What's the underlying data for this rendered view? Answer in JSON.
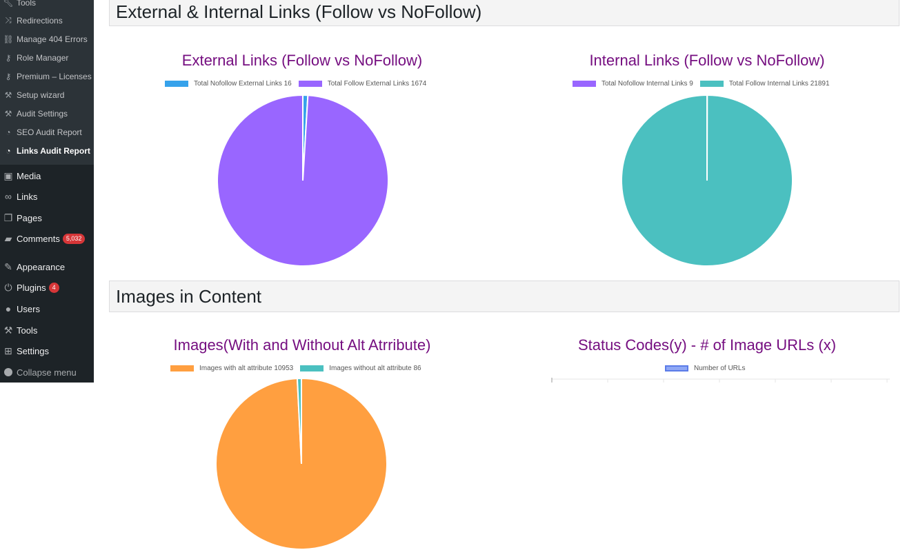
{
  "sidebar": {
    "submenu": [
      {
        "label": "Tools",
        "icon": "wrench-icon"
      },
      {
        "label": "Redirections",
        "icon": "shuffle-icon"
      },
      {
        "label": "Manage 404 Errors",
        "icon": "broken-link-icon"
      },
      {
        "label": "Role Manager",
        "icon": "key-icon"
      },
      {
        "label": "Premium – Licenses",
        "icon": "key-icon"
      },
      {
        "label": "Setup wizard",
        "icon": "wrench-icon"
      },
      {
        "label": "Audit Settings",
        "icon": "wrench-icon"
      },
      {
        "label": "SEO Audit Report",
        "icon": "gauge-icon"
      },
      {
        "label": "Links Audit Report",
        "icon": "gauge-icon"
      }
    ],
    "menu": [
      {
        "label": "Media",
        "icon": "media-icon"
      },
      {
        "label": "Links",
        "icon": "link-icon"
      },
      {
        "label": "Pages",
        "icon": "pages-icon"
      },
      {
        "label": "Comments",
        "icon": "comment-icon",
        "badge": "5,032"
      },
      {
        "label": "Appearance",
        "icon": "brush-icon"
      },
      {
        "label": "Plugins",
        "icon": "plugin-icon",
        "badge": "4"
      },
      {
        "label": "Users",
        "icon": "user-icon"
      },
      {
        "label": "Tools",
        "icon": "wrench-icon"
      },
      {
        "label": "Settings",
        "icon": "settings-icon"
      }
    ],
    "collapse_label": "Collapse menu"
  },
  "sections": {
    "links_title": "External & Internal Links (Follow vs NoFollow)",
    "images_title": "Images in Content"
  },
  "colors": {
    "blue": "#36a2eb",
    "purple": "#9966ff",
    "teal": "#4bc0c0",
    "orange": "#ff9f40",
    "title": "#750e80"
  },
  "chart_data": [
    {
      "type": "pie",
      "title": "External Links (Follow vs NoFollow)",
      "labels": [
        "Total Nofollow External Links 16",
        "Total Follow External Links 1674"
      ],
      "values": [
        16,
        1674
      ],
      "colors": [
        "#36a2eb",
        "#9966ff"
      ]
    },
    {
      "type": "pie",
      "title": "Internal Links (Follow vs NoFollow)",
      "labels": [
        "Total Nofollow Internal Links 9",
        "Total Follow Internal Links 21891"
      ],
      "values": [
        9,
        21891
      ],
      "colors": [
        "#9966ff",
        "#4bc0c0"
      ]
    },
    {
      "type": "pie",
      "title": "Images(With and Without Alt Atrribute)",
      "labels": [
        "Images with alt attribute 10953",
        "Images without alt attribute 86"
      ],
      "values": [
        10953,
        86
      ],
      "colors": [
        "#ff9f40",
        "#4bc0c0"
      ]
    },
    {
      "type": "bar",
      "title": "Status Codes(y) - # of Image URLs (x)",
      "series": [
        {
          "name": "Number of URLs",
          "values": []
        }
      ],
      "colors": [
        "#8fa8f5"
      ]
    }
  ]
}
